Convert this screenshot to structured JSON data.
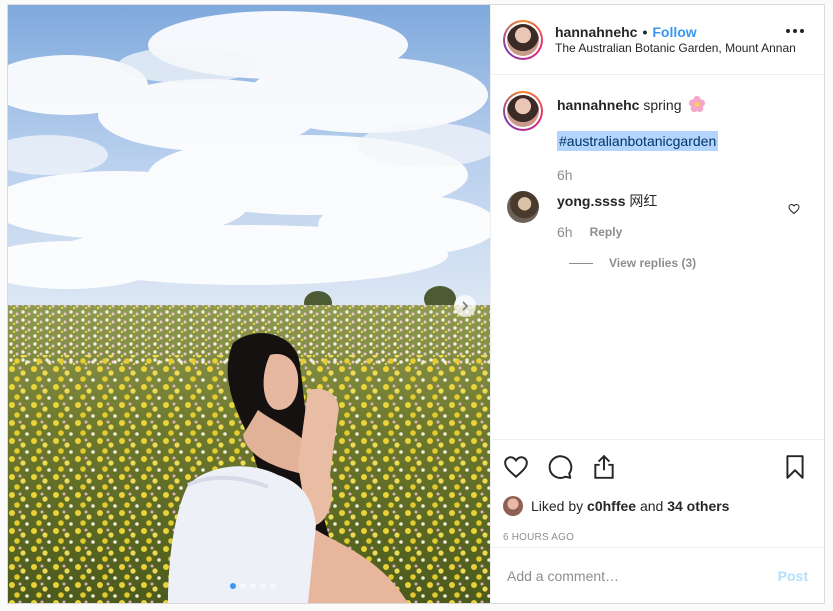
{
  "post": {
    "username": "hannahnehc",
    "follow_label": "Follow",
    "separator": "•",
    "location": "The Australian Botanic Garden, Mount Annan",
    "photo_alt": "",
    "carousel": {
      "count": 5,
      "active_index": 0
    }
  },
  "caption": {
    "username": "hannahnehc",
    "text": "spring",
    "emoji_icon": "pink-flower-icon",
    "hashtag": "#australianbotanicgarden",
    "time": "6h"
  },
  "comments": [
    {
      "username": "yong.ssss",
      "text": "网红",
      "time": "6h",
      "reply_label": "Reply",
      "view_replies_label": "View replies (3)"
    }
  ],
  "actions": {
    "icons": [
      "heart-icon",
      "comment-icon",
      "share-icon",
      "bookmark-icon"
    ],
    "liked_prefix": "Liked by",
    "liked_user": "c0hffee",
    "liked_and": "and",
    "liked_others": "34 others",
    "timestamp": "6 HOURS AGO"
  },
  "add_comment": {
    "placeholder": "Add a comment…",
    "post_label": "Post"
  },
  "colors": {
    "accent": "#3897f0",
    "muted": "#8e8e8e",
    "post_disabled": "#b2dffc",
    "hashtag_highlight": "#b3d4fc"
  }
}
